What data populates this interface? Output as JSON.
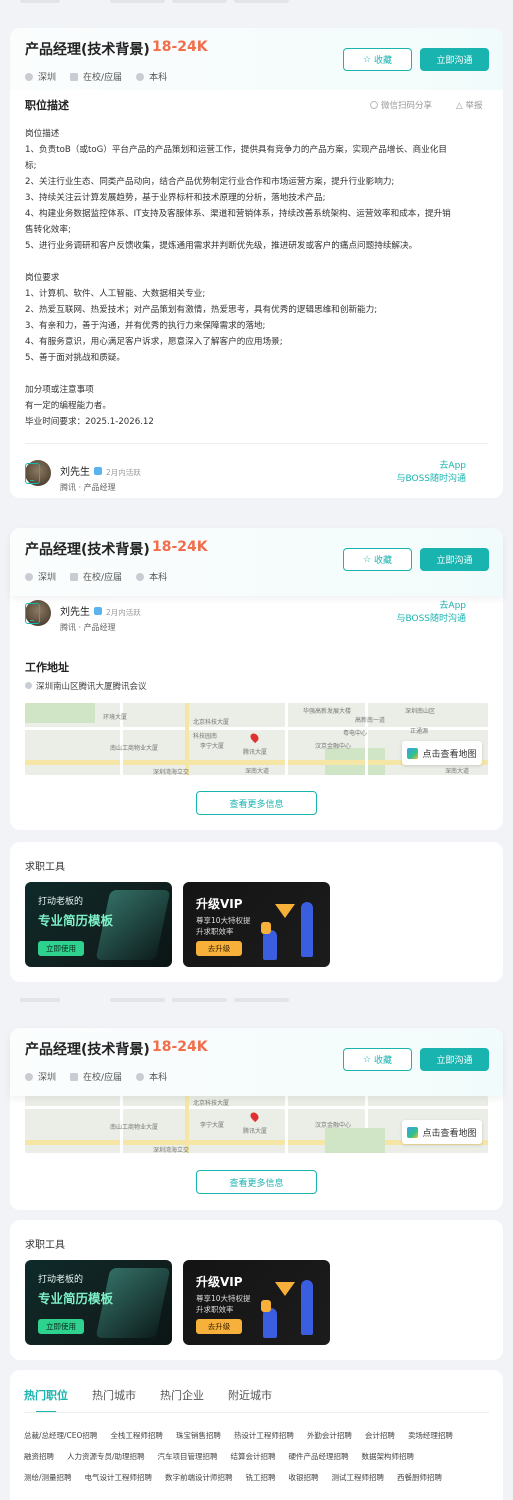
{
  "job": {
    "title": "产品经理(技术背景)",
    "salary": "18-24K",
    "city": "深圳",
    "experience": "在校/应届",
    "degree": "本科",
    "fav_label": "收藏",
    "chat_label": "立即沟通"
  },
  "description": {
    "heading": "职位描述",
    "share": "微信扫码分享",
    "report": "举报",
    "lines": [
      "岗位描述",
      "1、负责toB（或toG）平台产品的产品策划和运营工作，提供具有竞争力的产品方案，实现产品增长、商业化目",
      "标;",
      "2、关注行业生态、同类产品动向，结合产品优势制定行业合作和市场运营方案，提升行业影响力;",
      "3、持续关注云计算发展趋势，基于业界标杆和技术原理的分析，落地技术产品;",
      "4、构建业务数据监控体系、IT支持及客服体系、渠道和营销体系，持续改善系统架构、运营效率和成本，提升销",
      "售转化效率;",
      "5、进行业务调研和客户反馈收集，提炼通用需求并判断优先级，推进研发或客户的痛点问题持续解决。",
      "",
      "岗位要求",
      "1、计算机、软件、人工智能、大数据相关专业;",
      "2、热爱互联网、热爱技术；对产品策划有激情，热爱思考，具有优秀的逻辑思维和创新能力;",
      "3、有亲和力，善于沟通，并有优秀的执行力来保障需求的落地;",
      "4、有服务意识，用心满足客户诉求，愿意深入了解客户的应用场景;",
      "5、善于面对挑战和质疑。",
      "",
      "加分项或注意事项",
      "有一定的编程能力者。",
      "毕业时间要求：2025.1-2026.12"
    ]
  },
  "recruiter": {
    "name": "刘先生",
    "active": "2月内活跃",
    "company_title": "腾讯 · 产品经理",
    "go_app": "去App",
    "go_app_2": "与BOSS随时沟通"
  },
  "address": {
    "heading": "工作地址",
    "text": "深圳南山区腾讯大厦腾讯会议",
    "map_button": "点击查看地图",
    "more_button": "查看更多信息",
    "map_labels": [
      "环境大厦",
      "华强高新发展大楼",
      "北京科技大厦",
      "科技园南",
      "南山工商物业大厦",
      "李宁大厦",
      "腾讯大厦",
      "汉京金融中心",
      "深圳湾海立交",
      "深南大道",
      "高新南一道",
      "粤电中心",
      "深圳南山区",
      "正通源",
      "深南大道"
    ]
  },
  "tools": {
    "heading": "求职工具",
    "resume": {
      "line1": "打动老板的",
      "line2": "专业简历模板",
      "button": "立即使用"
    },
    "vip": {
      "line1": "升级VIP",
      "line2": "尊享10大特权提升求职效率",
      "button": "去升级"
    }
  },
  "bottom_tabs": [
    "热门职位",
    "热门城市",
    "热门企业",
    "附近城市"
  ],
  "links": [
    [
      "总裁/总经理/CEO招聘",
      "全栈工程师招聘",
      "珠宝销售招聘",
      "热设计工程师招聘",
      "外勤会计招聘",
      "会计招聘",
      "卖场经理招聘"
    ],
    [
      "融资招聘",
      "人力资源专员/助理招聘",
      "汽车项目管理招聘",
      "结算会计招聘",
      "硬件产品经理招聘",
      "数据架构师招聘"
    ],
    [
      "测绘/测量招聘",
      "电气设计工程师招聘",
      "数字前端设计师招聘",
      "铣工招聘",
      "收银招聘",
      "测试工程师招聘",
      "西餐厨师招聘"
    ]
  ],
  "colors": {
    "accent": "#19b4b0",
    "salary": "#f26d49"
  }
}
